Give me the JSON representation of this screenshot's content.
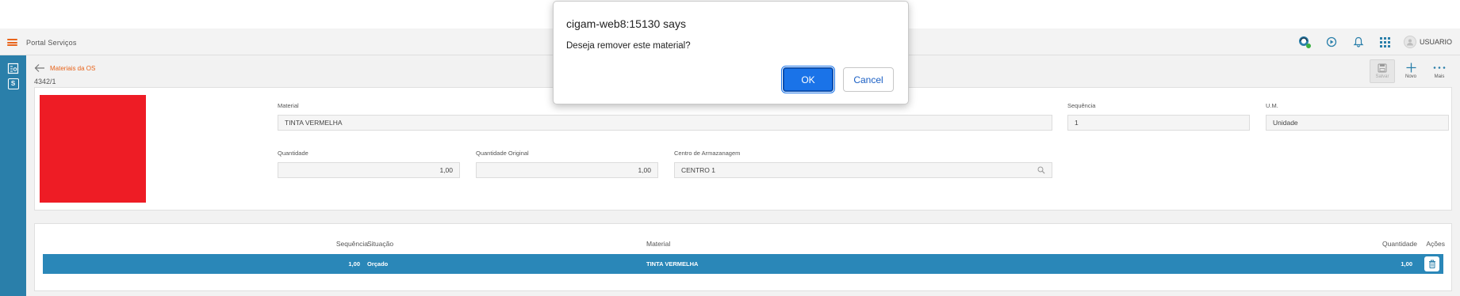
{
  "app": {
    "title": "Portal Serviços",
    "user_name": "USUARIO",
    "colors": {
      "accent": "#e8641b",
      "sidebar": "#2a7faa",
      "row_selected": "#2a87b8",
      "swatch": "#ee1c25"
    },
    "icons": [
      "menu-icon",
      "support-icon",
      "play-icon",
      "bell-icon",
      "apps-grid-icon",
      "user-icon"
    ]
  },
  "sidebar": {
    "items": [
      {
        "icon": "list-icon"
      },
      {
        "icon": "s-badge-icon",
        "label": "S"
      }
    ]
  },
  "page": {
    "breadcrumb": "Materiais da OS",
    "record_id": "4342/1",
    "toolbar": {
      "save_label": "Salvar",
      "new_label": "Novo",
      "more_label": "Mais"
    }
  },
  "form": {
    "material": {
      "label": "Material",
      "value": "TINTA VERMELHA"
    },
    "sequencia": {
      "label": "Sequência",
      "value": "1"
    },
    "um": {
      "label": "U.M.",
      "value": "Unidade"
    },
    "quantidade": {
      "label": "Quantidade",
      "value": "1,00"
    },
    "quantidade_original": {
      "label": "Quantidade Original",
      "value": "1,00"
    },
    "centro": {
      "label": "Centro de Armazanagem",
      "value": "CENTRO 1"
    }
  },
  "table": {
    "headers": {
      "sequencia": "Sequência",
      "situacao": "Situação",
      "material": "Material",
      "quantidade": "Quantidade",
      "acoes": "Ações"
    },
    "rows": [
      {
        "sequencia": "1,00",
        "situacao": "Orçado",
        "material": "TINTA VERMELHA",
        "quantidade": "1,00"
      }
    ]
  },
  "dialog": {
    "title": "cigam-web8:15130 says",
    "message": "Deseja remover este material?",
    "ok_label": "OK",
    "cancel_label": "Cancel"
  }
}
